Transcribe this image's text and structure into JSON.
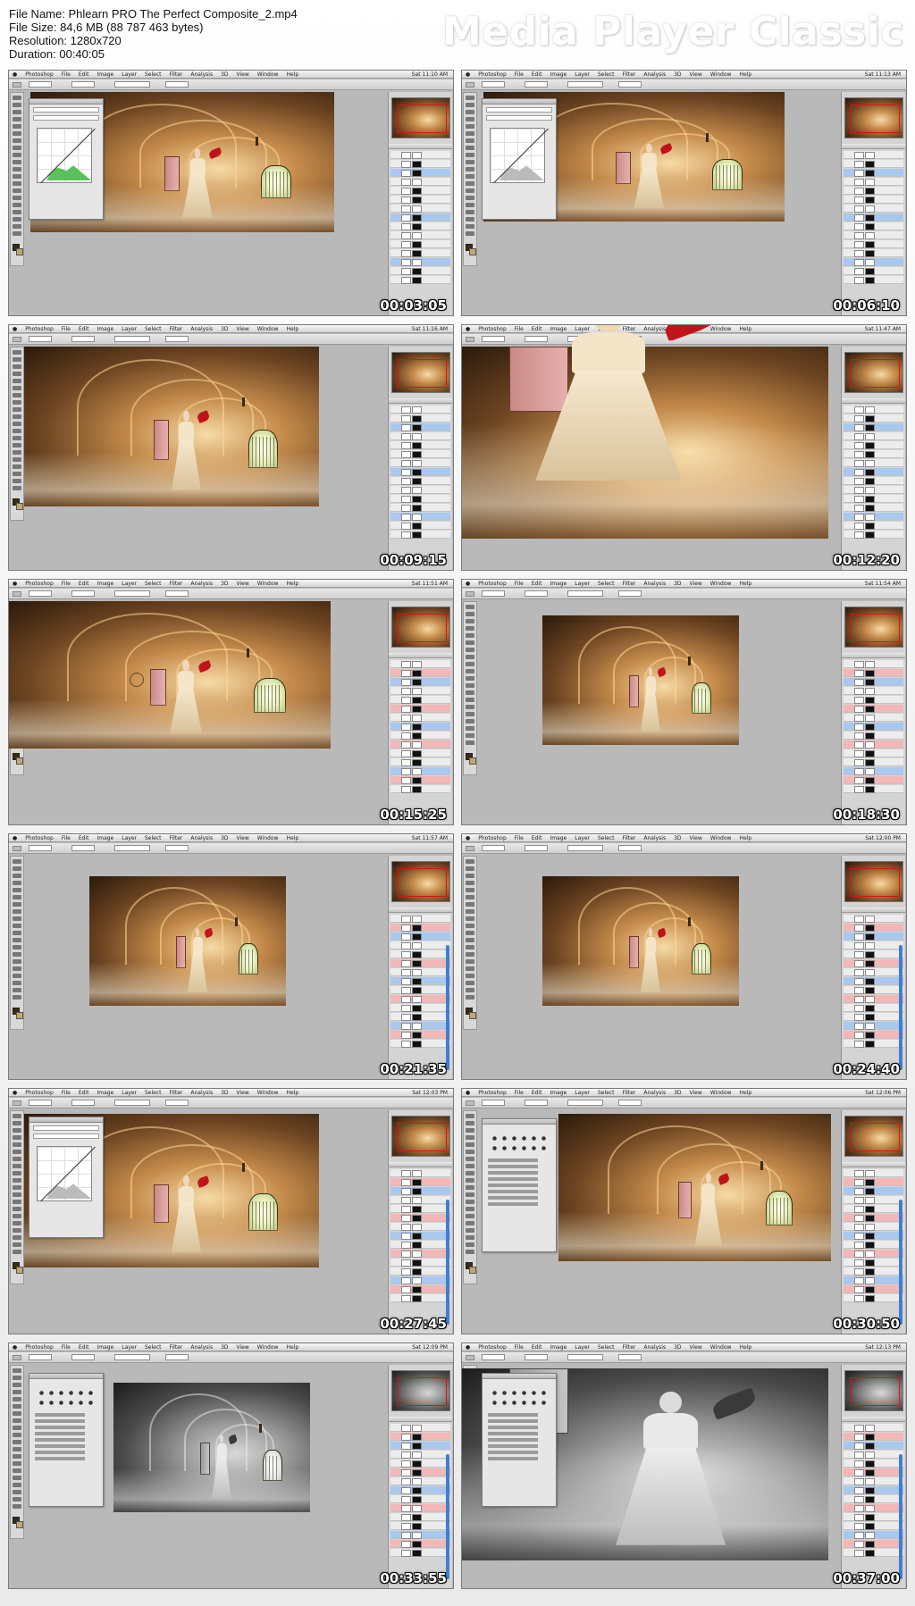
{
  "file_info": {
    "name": "File Name: Phlearn PRO The Perfect Composite_2.mp4",
    "size": "File Size: 84,6 MB (88 787 463 bytes)",
    "resolution": "Resolution: 1280x720",
    "duration": "Duration: 00:40:05"
  },
  "brand": "Media Player Classic",
  "colors": {
    "accent_red": "#c0141a",
    "selection_blue": "#a8c8f0",
    "stone_warm": "#8a5a2c",
    "window_light": "#e9f0c0"
  },
  "icons": [
    "apple-icon",
    "toolbox-icon",
    "navigator-frame-icon",
    "layer-thumbnail-icon",
    "brush-cursor-icon"
  ],
  "menu": {
    "apple": "",
    "items": [
      "Photoshop",
      "File",
      "Edit",
      "Image",
      "Layer",
      "Select",
      "Filter",
      "Analysis",
      "3D",
      "View",
      "Window",
      "Help"
    ]
  },
  "thumbnails": [
    {
      "timestamp": "00:03:05",
      "clock": "Sat 11:10 AM"
    },
    {
      "timestamp": "00:06:10",
      "clock": "Sat 11:13 AM"
    },
    {
      "timestamp": "00:09:15",
      "clock": "Sat 11:16 AM"
    },
    {
      "timestamp": "00:12:20",
      "clock": "Sat 11:47 AM"
    },
    {
      "timestamp": "00:15:25",
      "clock": "Sat 11:51 AM"
    },
    {
      "timestamp": "00:18:30",
      "clock": "Sat 11:54 AM"
    },
    {
      "timestamp": "00:21:35",
      "clock": "Sat 11:57 AM"
    },
    {
      "timestamp": "00:24:40",
      "clock": "Sat 12:00 PM"
    },
    {
      "timestamp": "00:27:45",
      "clock": "Sat 12:03 PM"
    },
    {
      "timestamp": "00:30:50",
      "clock": "Sat 12:06 PM"
    },
    {
      "timestamp": "00:33:55",
      "clock": "Sat 12:09 PM"
    },
    {
      "timestamp": "00:37:00",
      "clock": "Sat 12:13 PM"
    }
  ]
}
